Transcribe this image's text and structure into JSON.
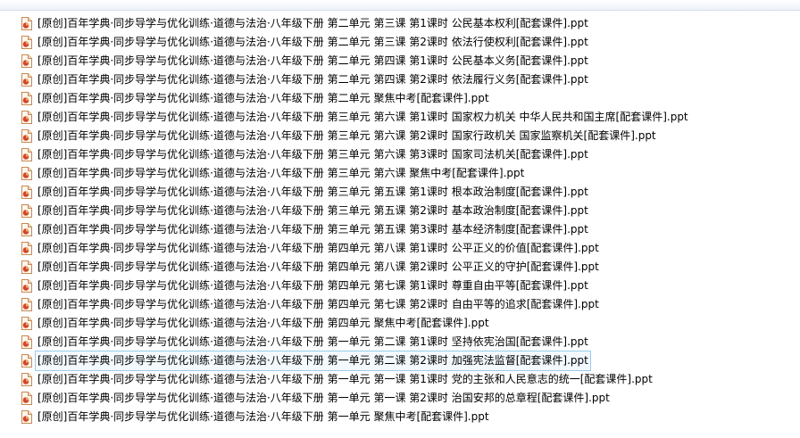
{
  "header": {
    "partial_text": ""
  },
  "files": [
    {
      "name": "[原创]百年学典·同步导学与优化训练·道德与法治·八年级下册 第二单元 第三课 第1课时 公民基本权利[配套课件].ppt"
    },
    {
      "name": "[原创]百年学典·同步导学与优化训练·道德与法治·八年级下册 第二单元 第三课 第2课时 依法行使权利[配套课件].ppt"
    },
    {
      "name": "[原创]百年学典·同步导学与优化训练·道德与法治·八年级下册 第二单元 第四课 第1课时 公民基本义务[配套课件].ppt"
    },
    {
      "name": "[原创]百年学典·同步导学与优化训练·道德与法治·八年级下册 第二单元 第四课 第2课时 依法履行义务[配套课件].ppt"
    },
    {
      "name": "[原创]百年学典·同步导学与优化训练·道德与法治·八年级下册 第二单元 聚焦中考[配套课件].ppt"
    },
    {
      "name": "[原创]百年学典·同步导学与优化训练·道德与法治·八年级下册 第三单元 第六课 第1课时 国家权力机关 中华人民共和国主席[配套课件].ppt"
    },
    {
      "name": "[原创]百年学典·同步导学与优化训练·道德与法治·八年级下册 第三单元 第六课 第2课时 国家行政机关 国家监察机关[配套课件].ppt"
    },
    {
      "name": "[原创]百年学典·同步导学与优化训练·道德与法治·八年级下册 第三单元 第六课 第3课时 国家司法机关[配套课件].ppt"
    },
    {
      "name": "[原创]百年学典·同步导学与优化训练·道德与法治·八年级下册 第三单元 第六课 聚焦中考[配套课件].ppt"
    },
    {
      "name": "[原创]百年学典·同步导学与优化训练·道德与法治·八年级下册 第三单元 第五课 第1课时 根本政治制度[配套课件].ppt"
    },
    {
      "name": "[原创]百年学典·同步导学与优化训练·道德与法治·八年级下册 第三单元 第五课 第2课时 基本政治制度[配套课件].ppt"
    },
    {
      "name": "[原创]百年学典·同步导学与优化训练·道德与法治·八年级下册 第三单元 第五课 第3课时 基本经济制度[配套课件].ppt"
    },
    {
      "name": "[原创]百年学典·同步导学与优化训练·道德与法治·八年级下册 第四单元 第八课 第1课时 公平正义的价值[配套课件].ppt"
    },
    {
      "name": "[原创]百年学典·同步导学与优化训练·道德与法治·八年级下册 第四单元 第八课 第2课时 公平正义的守护[配套课件].ppt"
    },
    {
      "name": "[原创]百年学典·同步导学与优化训练·道德与法治·八年级下册 第四单元 第七课 第1课时 尊重自由平等[配套课件].ppt"
    },
    {
      "name": "[原创]百年学典·同步导学与优化训练·道德与法治·八年级下册 第四单元 第七课 第2课时 自由平等的追求[配套课件].ppt"
    },
    {
      "name": "[原创]百年学典·同步导学与优化训练·道德与法治·八年级下册 第四单元 聚焦中考[配套课件].ppt"
    },
    {
      "name": "[原创]百年学典·同步导学与优化训练·道德与法治·八年级下册 第一单元 第二课 第1课时 坚持依宪治国[配套课件].ppt"
    },
    {
      "name": "[原创]百年学典·同步导学与优化训练·道德与法治·八年级下册 第一单元 第二课 第2课时 加强宪法监督[配套课件].ppt",
      "selected": true
    },
    {
      "name": "[原创]百年学典·同步导学与优化训练·道德与法治·八年级下册 第一单元 第一课 第1课时 党的主张和人民意志的统一[配套课件].ppt"
    },
    {
      "name": "[原创]百年学典·同步导学与优化训练·道德与法治·八年级下册 第一单元 第一课 第2课时 治国安邦的总章程[配套课件].ppt"
    },
    {
      "name": "[原创]百年学典·同步导学与优化训练·道德与法治·八年级下册 第一单元 聚焦中考[配套课件].ppt"
    }
  ],
  "icon": "ppt-file-icon",
  "colors": {
    "icon_orange": "#d24726",
    "selection_border": "#99ccee"
  }
}
